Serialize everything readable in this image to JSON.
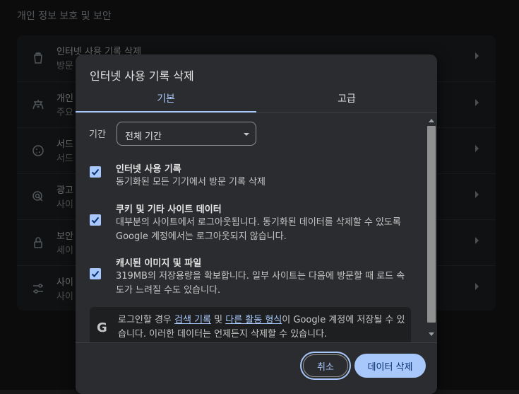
{
  "page": {
    "section_title": "개인 정보 보호 및 보안",
    "rows": [
      {
        "icon": "trash-icon",
        "title": "인터넷 사용 기록 삭제",
        "subtitle": "방문"
      },
      {
        "icon": "privacy-guide-icon",
        "title": "개인",
        "subtitle": "주요"
      },
      {
        "icon": "cookie-icon",
        "title": "서드",
        "subtitle": "서드"
      },
      {
        "icon": "ad-privacy-icon",
        "title": "광고",
        "subtitle": "사이"
      },
      {
        "icon": "lock-icon",
        "title": "보안",
        "subtitle": "세이"
      },
      {
        "icon": "site-settings-icon",
        "title": "사이",
        "subtitle": "사이"
      }
    ]
  },
  "dialog": {
    "title": "인터넷 사용 기록 삭제",
    "tabs": [
      {
        "label": "기본",
        "active": true
      },
      {
        "label": "고급",
        "active": false
      }
    ],
    "period": {
      "label": "기간",
      "value": "전체 기간"
    },
    "items": [
      {
        "title": "인터넷 사용 기록",
        "desc": "동기화된 모든 기기에서 방문 기록 삭제",
        "checked": true
      },
      {
        "title": "쿠키 및 기타 사이트 데이터",
        "desc": "대부분의 사이트에서 로그아웃됩니다. 동기화된 데이터를 삭제할 수 있도록 Google 계정에서는 로그아웃되지 않습니다.",
        "checked": true
      },
      {
        "title": "캐시된 이미지 및 파일",
        "desc": "319MB의 저장용량을 확보합니다. 일부 사이트는 다음에 방문할 때 로드 속도가 느려질 수도 있습니다.",
        "checked": true
      }
    ],
    "google_notice": {
      "prefix": "로그인할 경우 ",
      "link1": "검색 기록",
      "mid": " 및 ",
      "link2": "다른 활동 형식",
      "suffix": "이 Google 계정에 저장될 수 있습니다. 이러한 데이터는 언제든지 삭제할 수 있습니다."
    },
    "buttons": {
      "cancel": "취소",
      "delete": "데이터 삭제"
    }
  },
  "colors": {
    "accent": "#a8c7fa",
    "dialog_bg": "#2b2c2f",
    "page_bg": "#171717"
  }
}
